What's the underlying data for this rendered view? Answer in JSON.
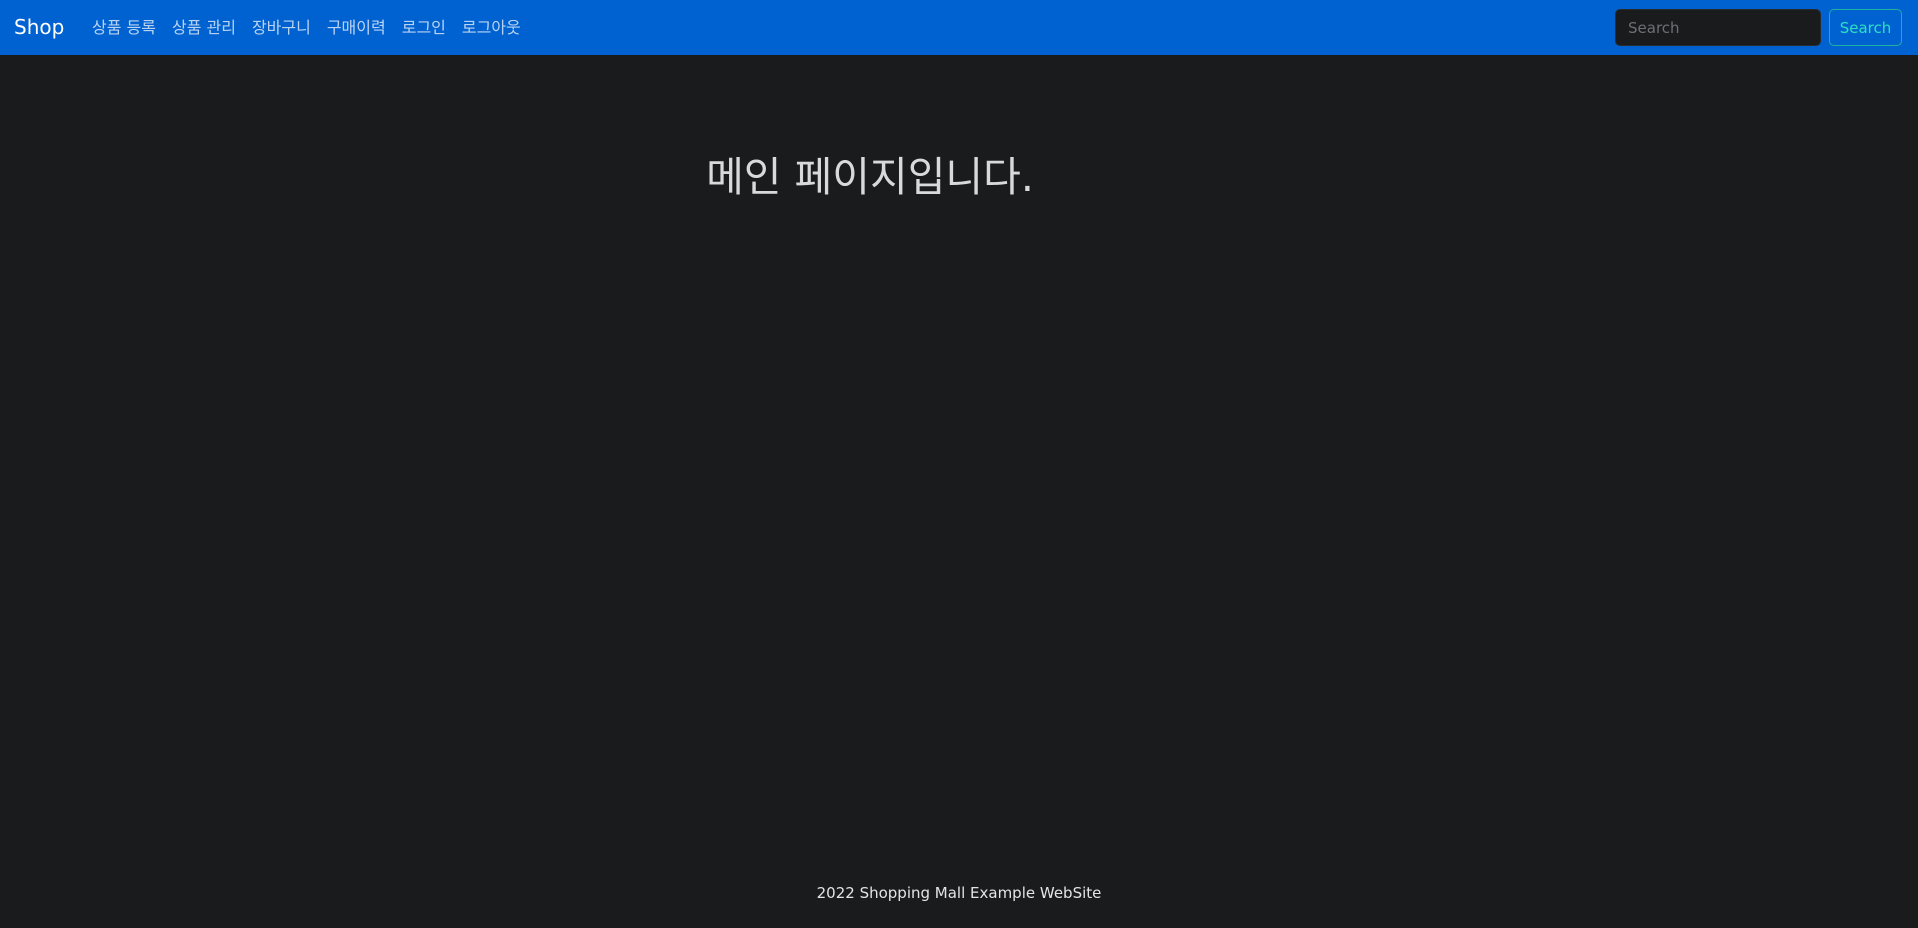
{
  "navbar": {
    "brand": "Shop",
    "links": [
      {
        "label": "상품 등록"
      },
      {
        "label": "상품 관리"
      },
      {
        "label": "장바구니"
      },
      {
        "label": "구매이력"
      },
      {
        "label": "로그인"
      },
      {
        "label": "로그아웃"
      }
    ],
    "search": {
      "placeholder": "Search",
      "value": "",
      "button_label": "Search"
    }
  },
  "main": {
    "title": "메인 페이지입니다."
  },
  "footer": {
    "text": "2022 Shopping Mall Example WebSite"
  },
  "colors": {
    "navbar_bg": "#0062d1",
    "page_bg": "#1a1b1d",
    "search_button_accent": "#1cb2a0"
  }
}
